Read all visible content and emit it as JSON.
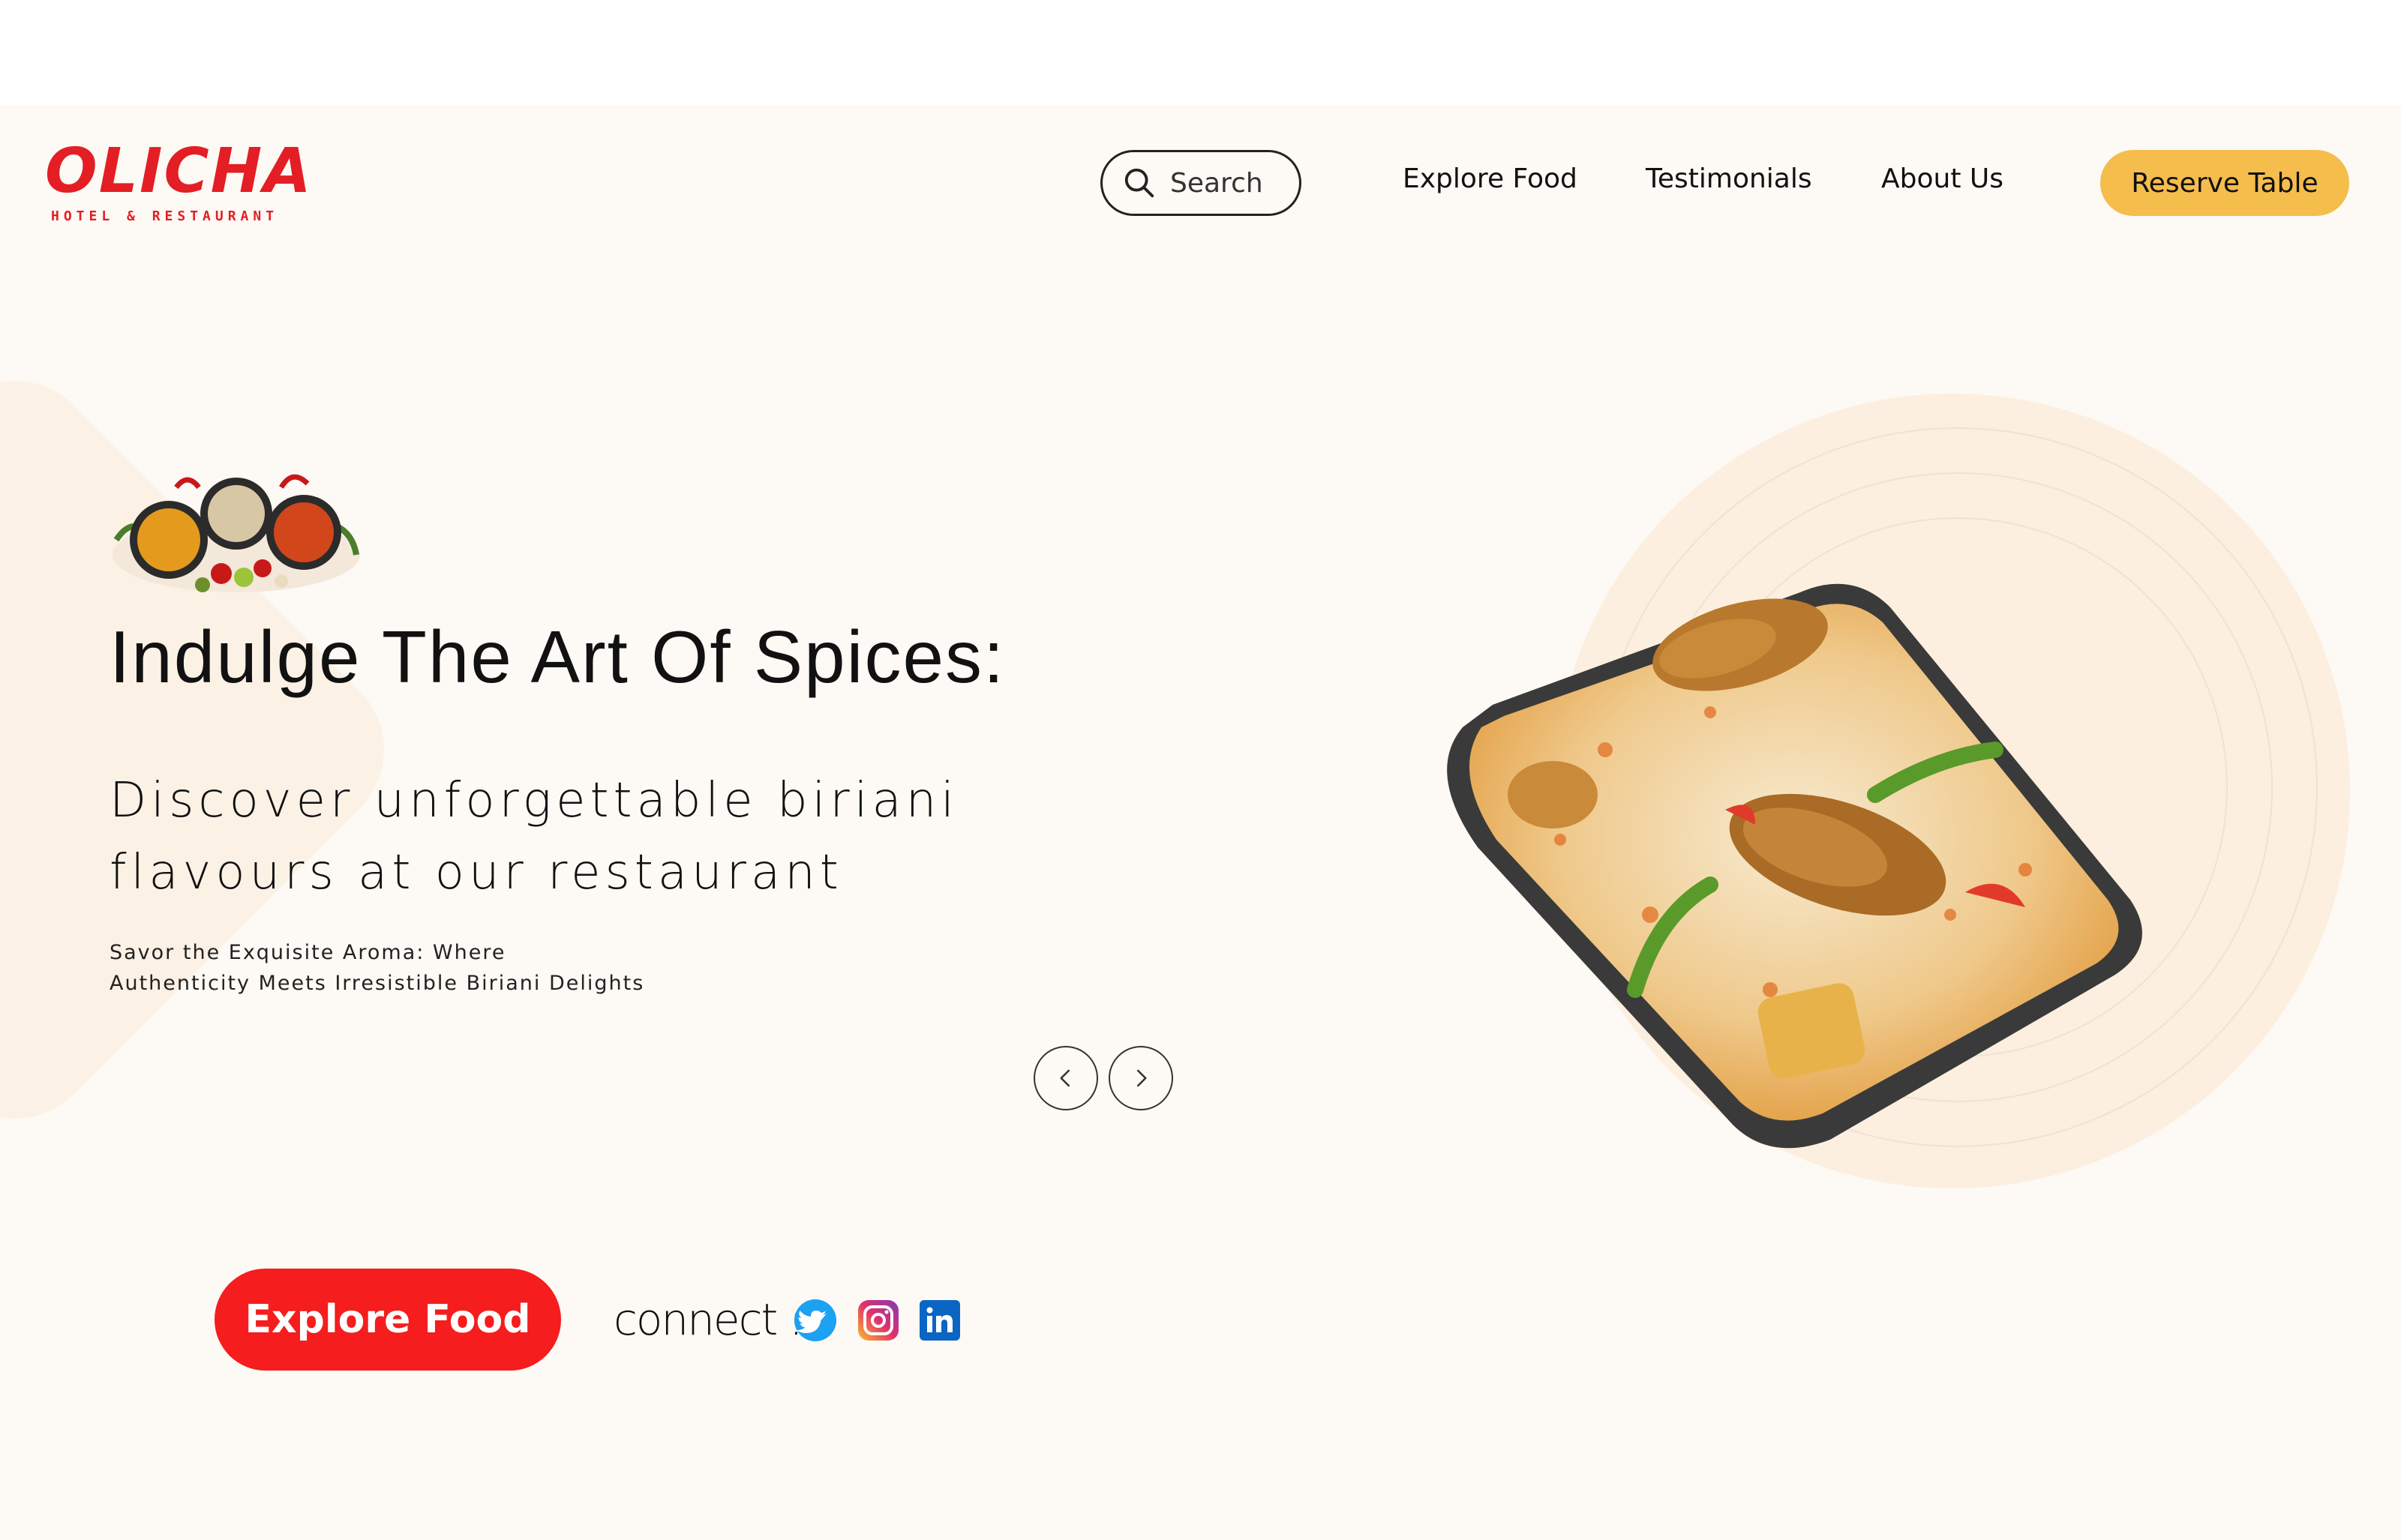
{
  "brand": {
    "name": "OLICHA",
    "tagline": "HOTEL & RESTAURANT",
    "color": "#e31e24"
  },
  "header": {
    "search_label": "Search",
    "nav": [
      "Explore Food",
      "Testimonials",
      "About Us"
    ],
    "reserve_label": "Reserve Table",
    "reserve_color": "#f4bd4c"
  },
  "hero": {
    "title": "Indulge The Art Of Spices:",
    "subtitle_line1": "Discover unforgettable biriani",
    "subtitle_line2": "flavours at our restaurant",
    "tagline_line1": "Savor the Exquisite Aroma: Where",
    "tagline_line2": "Authenticity Meets Irresistible Biriani Delights",
    "carousel": {
      "prev_icon": "chevron-left-icon",
      "next_icon": "chevron-right-icon"
    }
  },
  "cta": {
    "label": "Explore Food",
    "color": "#f51d1d"
  },
  "connect": {
    "label": "connect :",
    "icons": [
      "twitter-icon",
      "instagram-icon",
      "linkedin-icon"
    ]
  },
  "colors": {
    "background": "#fdf9f4",
    "accent_soft": "#fcefdf"
  }
}
